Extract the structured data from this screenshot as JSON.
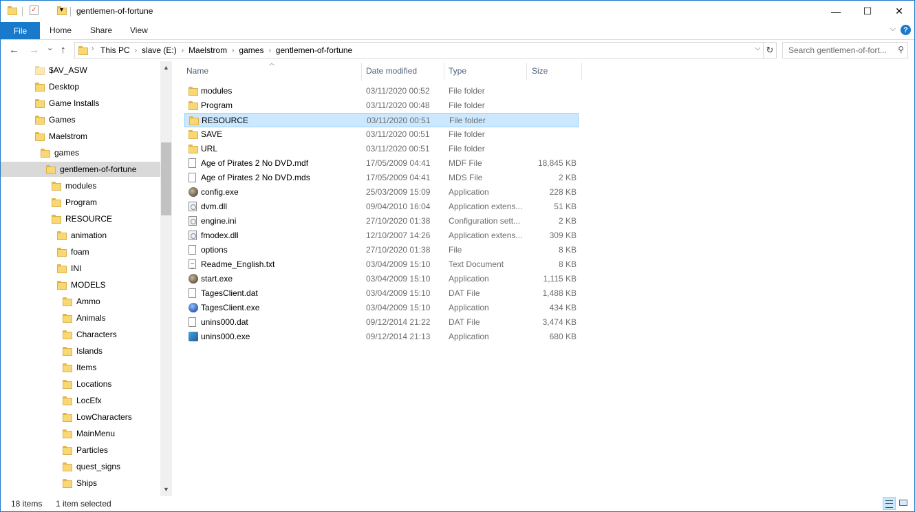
{
  "window": {
    "title": "gentlemen-of-fortune",
    "minimize": "—",
    "maximize": "☐",
    "close": "✕"
  },
  "ribbon": {
    "tabs": [
      "File",
      "Home",
      "Share",
      "View"
    ],
    "help": "?",
    "expand": "⌵"
  },
  "address": {
    "back": "←",
    "forward": "→",
    "recent": "⌄",
    "up": "↑",
    "crumbs": [
      "This PC",
      "slave (E:)",
      "Maelstrom",
      "games",
      "gentlemen-of-fortune"
    ],
    "crumb_sep": "›",
    "dropdown": "⌵",
    "refresh": "↻",
    "search_placeholder": "Search gentlemen-of-fort...",
    "search_icon": "⚲"
  },
  "nav_pane": {
    "items": [
      {
        "label": "$AV_ASW",
        "level": 0,
        "selected": false
      },
      {
        "label": "Desktop",
        "level": 0,
        "selected": false
      },
      {
        "label": "Game Installs",
        "level": 0,
        "selected": false
      },
      {
        "label": "Games",
        "level": 0,
        "selected": false
      },
      {
        "label": "Maelstrom",
        "level": 0,
        "selected": false
      },
      {
        "label": "games",
        "level": 1,
        "selected": false
      },
      {
        "label": "gentlemen-of-fortune",
        "level": 2,
        "selected": true
      },
      {
        "label": "modules",
        "level": 3,
        "selected": false
      },
      {
        "label": "Program",
        "level": 3,
        "selected": false
      },
      {
        "label": "RESOURCE",
        "level": 3,
        "selected": false
      },
      {
        "label": "animation",
        "level": 4,
        "selected": false
      },
      {
        "label": "foam",
        "level": 4,
        "selected": false
      },
      {
        "label": "INI",
        "level": 4,
        "selected": false
      },
      {
        "label": "MODELS",
        "level": 4,
        "selected": false
      },
      {
        "label": "Ammo",
        "level": 5,
        "selected": false
      },
      {
        "label": "Animals",
        "level": 5,
        "selected": false
      },
      {
        "label": "Characters",
        "level": 5,
        "selected": false
      },
      {
        "label": "Islands",
        "level": 5,
        "selected": false
      },
      {
        "label": "Items",
        "level": 5,
        "selected": false
      },
      {
        "label": "Locations",
        "level": 5,
        "selected": false
      },
      {
        "label": "LocEfx",
        "level": 5,
        "selected": false
      },
      {
        "label": "LowCharacters",
        "level": 5,
        "selected": false
      },
      {
        "label": "MainMenu",
        "level": 5,
        "selected": false
      },
      {
        "label": "Particles",
        "level": 5,
        "selected": false
      },
      {
        "label": "quest_signs",
        "level": 5,
        "selected": false
      },
      {
        "label": "Ships",
        "level": 5,
        "selected": false
      }
    ],
    "scroll_up": "▲",
    "scroll_down": "▼"
  },
  "file_list": {
    "columns": [
      "Name",
      "Date modified",
      "Type",
      "Size"
    ],
    "sort_indicator": "︿",
    "rows": [
      {
        "name": "modules",
        "date": "03/11/2020 00:52",
        "type": "File folder",
        "size": "",
        "icon": "folder-icon",
        "selected": false
      },
      {
        "name": "Program",
        "date": "03/11/2020 00:48",
        "type": "File folder",
        "size": "",
        "icon": "folder-icon",
        "selected": false
      },
      {
        "name": "RESOURCE",
        "date": "03/11/2020 00:51",
        "type": "File folder",
        "size": "",
        "icon": "folder-icon",
        "selected": true
      },
      {
        "name": "SAVE",
        "date": "03/11/2020 00:51",
        "type": "File folder",
        "size": "",
        "icon": "folder-icon",
        "selected": false
      },
      {
        "name": "URL",
        "date": "03/11/2020 00:51",
        "type": "File folder",
        "size": "",
        "icon": "folder-icon",
        "selected": false
      },
      {
        "name": "Age of Pirates 2 No DVD.mdf",
        "date": "17/05/2009 04:41",
        "type": "MDF File",
        "size": "18,845 KB",
        "icon": "file-icon",
        "selected": false
      },
      {
        "name": "Age of Pirates 2 No DVD.mds",
        "date": "17/05/2009 04:41",
        "type": "MDS File",
        "size": "2 KB",
        "icon": "file-icon",
        "selected": false
      },
      {
        "name": "config.exe",
        "date": "25/03/2009 15:09",
        "type": "Application",
        "size": "228 KB",
        "icon": "app-icon",
        "selected": false
      },
      {
        "name": "dvm.dll",
        "date": "09/04/2010 16:04",
        "type": "Application extens...",
        "size": "51 KB",
        "icon": "dll-icon",
        "selected": false
      },
      {
        "name": "engine.ini",
        "date": "27/10/2020 01:38",
        "type": "Configuration sett...",
        "size": "2 KB",
        "icon": "settings-file-icon",
        "selected": false
      },
      {
        "name": "fmodex.dll",
        "date": "12/10/2007 14:26",
        "type": "Application extens...",
        "size": "309 KB",
        "icon": "dll-icon",
        "selected": false
      },
      {
        "name": "options",
        "date": "27/10/2020 01:38",
        "type": "File",
        "size": "8 KB",
        "icon": "file-icon",
        "selected": false
      },
      {
        "name": "Readme_English.txt",
        "date": "03/04/2009 15:10",
        "type": "Text Document",
        "size": "8 KB",
        "icon": "text-file-icon",
        "selected": false
      },
      {
        "name": "start.exe",
        "date": "03/04/2009 15:10",
        "type": "Application",
        "size": "1,115 KB",
        "icon": "app-icon",
        "selected": false
      },
      {
        "name": "TagesClient.dat",
        "date": "03/04/2009 15:10",
        "type": "DAT File",
        "size": "1,488 KB",
        "icon": "file-icon",
        "selected": false
      },
      {
        "name": "TagesClient.exe",
        "date": "03/04/2009 15:10",
        "type": "Application",
        "size": "434 KB",
        "icon": "globe-app-icon",
        "selected": false
      },
      {
        "name": "unins000.dat",
        "date": "09/12/2014 21:22",
        "type": "DAT File",
        "size": "3,474 KB",
        "icon": "file-icon",
        "selected": false
      },
      {
        "name": "unins000.exe",
        "date": "09/12/2014 21:13",
        "type": "Application",
        "size": "680 KB",
        "icon": "setup-app-icon",
        "selected": false
      }
    ]
  },
  "status": {
    "item_count": "18 items",
    "selection": "1 item selected"
  },
  "colors": {
    "accent": "#1979ca",
    "selection_bg": "#cce8ff",
    "selection_border": "#99d1ff",
    "folder": "#f8d775"
  }
}
